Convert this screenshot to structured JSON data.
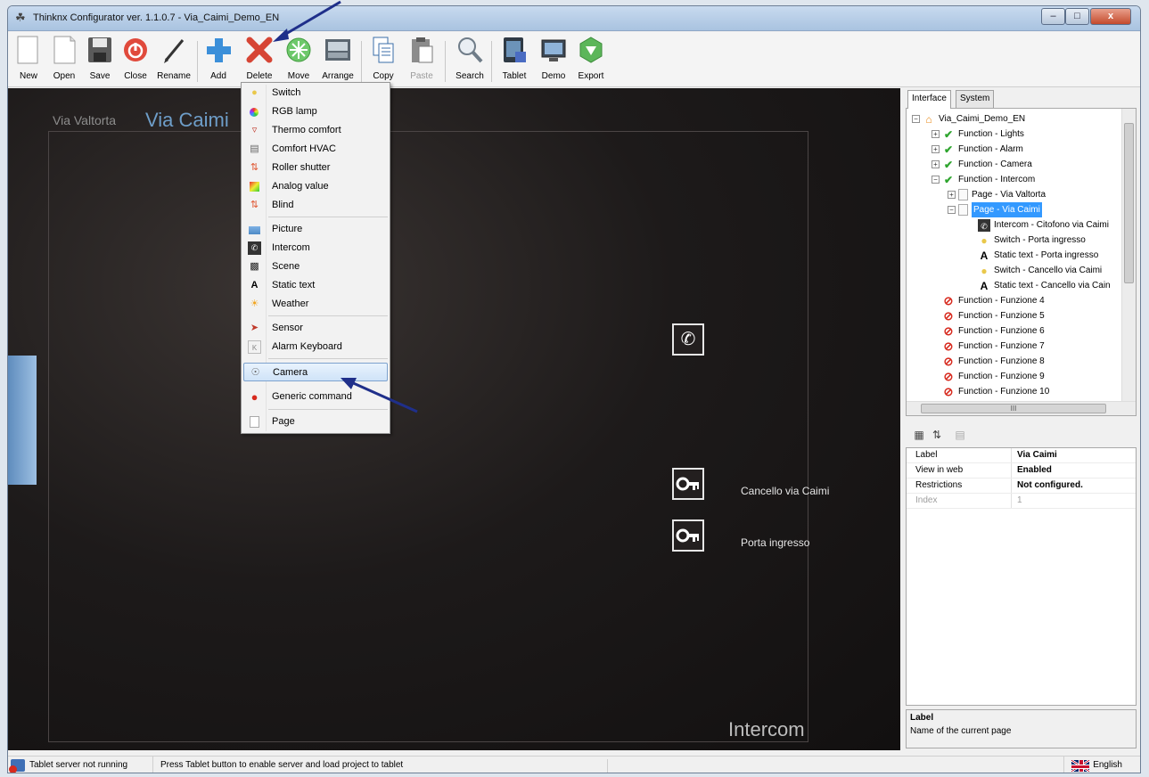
{
  "window": {
    "title": "Thinknx Configurator ver. 1.1.0.7 - Via_Caimi_Demo_EN",
    "close_glyph": "x",
    "min_glyph": "–",
    "max_glyph": "□"
  },
  "toolbar": {
    "new": "New",
    "open": "Open",
    "save": "Save",
    "close": "Close",
    "rename": "Rename",
    "add": "Add",
    "delete": "Delete",
    "move": "Move",
    "arrange": "Arrange",
    "copy": "Copy",
    "paste": "Paste",
    "search": "Search",
    "tablet": "Tablet",
    "demo": "Demo",
    "export": "Export"
  },
  "add_menu": {
    "items": [
      "Switch",
      "RGB lamp",
      "Thermo comfort",
      "Comfort HVAC",
      "Roller shutter",
      "Analog value",
      "Blind",
      "Picture",
      "Intercom",
      "Scene",
      "Static text",
      "Weather",
      "Sensor",
      "Alarm Keyboard",
      "Camera",
      "Generic command",
      "Page"
    ],
    "highlighted": "Camera"
  },
  "canvas": {
    "breadcrumb_prev": "Via Valtorta",
    "breadcrumb_current": "Via Caimi",
    "widget_gate_label": "Cancello via Caimi",
    "widget_door_label": "Porta ingresso",
    "page_title": "Intercom"
  },
  "right_panel": {
    "tab_interface": "Interface",
    "tab_system": "System",
    "tree": {
      "root": "Via_Caimi_Demo_EN",
      "f_lights": "Function - Lights",
      "f_alarm": "Function - Alarm",
      "f_camera": "Function - Camera",
      "f_intercom": "Function - Intercom",
      "p_valtorta": "Page - Via Valtorta",
      "p_caimi": "Page - Via Caimi",
      "c1": "Intercom - Citofono via Caimi",
      "c2": "Switch - Porta ingresso",
      "c3": "Static text - Porta ingresso",
      "c4": "Switch - Cancello via Caimi",
      "c5": "Static text - Cancello via Cain",
      "f4": "Function - Funzione 4",
      "f5": "Function - Funzione 5",
      "f6": "Function - Funzione 6",
      "f7": "Function - Funzione 7",
      "f8": "Function - Funzione 8",
      "f9": "Function - Funzione 9",
      "f10": "Function - Funzione 10"
    },
    "hscroll_grip": "III",
    "properties": {
      "label_key": "Label",
      "label_val": "Via Caimi",
      "web_key": "View in web",
      "web_val": "Enabled",
      "restr_key": "Restrictions",
      "restr_val": "Not configured.",
      "index_key": "Index",
      "index_val": "1"
    },
    "help_title": "Label",
    "help_text": "Name of the current page"
  },
  "statusbar": {
    "server": "Tablet server not running",
    "hint": "Press Tablet button to enable server and load project to tablet",
    "language": "English"
  },
  "colors": {
    "accent_blue": "#6e9ec9",
    "selection": "#3399ff",
    "canvas_dark": "#1d1a1a",
    "arrow": "#1f2f8a"
  }
}
